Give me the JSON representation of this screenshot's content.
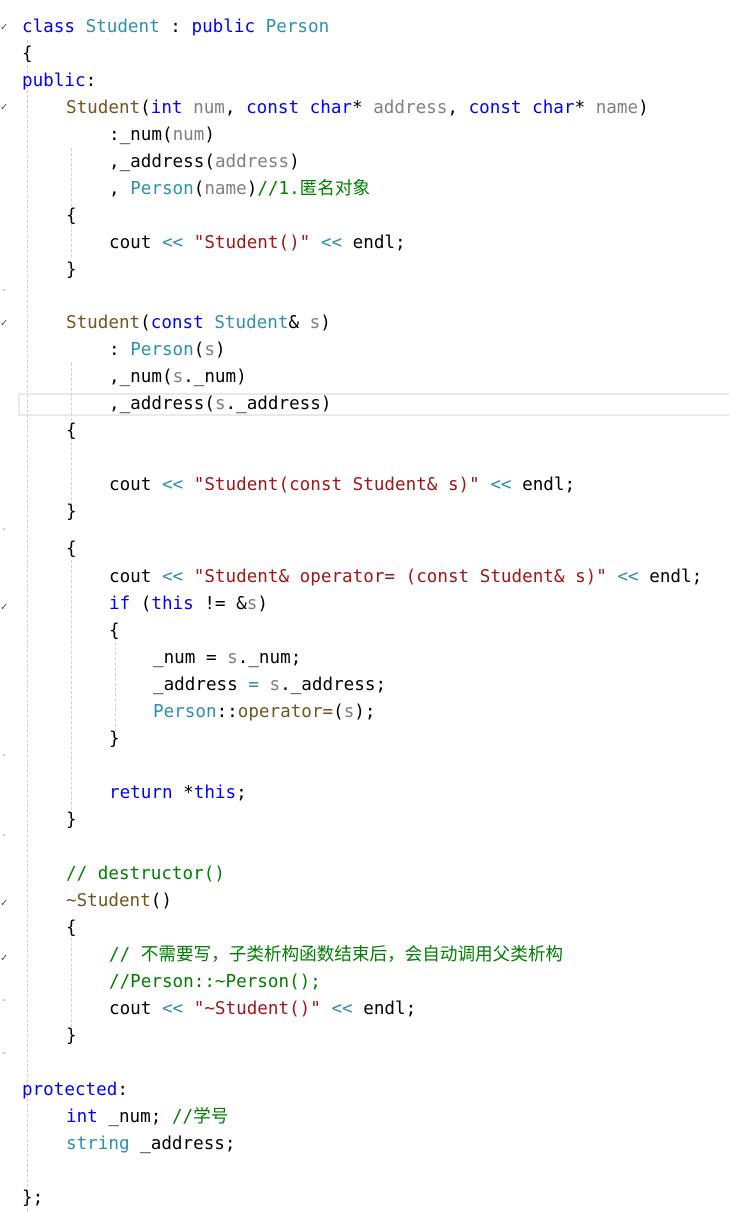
{
  "lines": [
    {
      "indent": 0,
      "tokens": [
        [
          "kw",
          "class"
        ],
        [
          "op",
          " "
        ],
        [
          "ty",
          "Student"
        ],
        [
          "op",
          " : "
        ],
        [
          "kw",
          "public"
        ],
        [
          "op",
          " "
        ],
        [
          "ty",
          "Person"
        ]
      ]
    },
    {
      "indent": 0,
      "tokens": [
        [
          "op",
          "{"
        ]
      ]
    },
    {
      "indent": 0,
      "tokens": [
        [
          "kw",
          "public"
        ],
        [
          "op",
          ":"
        ]
      ]
    },
    {
      "indent": 1,
      "tokens": [
        [
          "fn",
          "Student"
        ],
        [
          "op",
          "("
        ],
        [
          "kw",
          "int"
        ],
        [
          "op",
          " "
        ],
        [
          "pm",
          "num"
        ],
        [
          "op",
          ", "
        ],
        [
          "kw",
          "const"
        ],
        [
          "op",
          " "
        ],
        [
          "kw",
          "char"
        ],
        [
          "op",
          "* "
        ],
        [
          "pm",
          "address"
        ],
        [
          "op",
          ", "
        ],
        [
          "kw",
          "const"
        ],
        [
          "op",
          " "
        ],
        [
          "kw",
          "char"
        ],
        [
          "op",
          "* "
        ],
        [
          "pm",
          "name"
        ],
        [
          "op",
          ")"
        ]
      ]
    },
    {
      "indent": 2,
      "tokens": [
        [
          "op",
          ":"
        ],
        [
          "mb",
          "_num"
        ],
        [
          "op",
          "("
        ],
        [
          "pm",
          "num"
        ],
        [
          "op",
          ")"
        ]
      ]
    },
    {
      "indent": 2,
      "tokens": [
        [
          "op",
          ","
        ],
        [
          "mb",
          "_address"
        ],
        [
          "op",
          "("
        ],
        [
          "pm",
          "address"
        ],
        [
          "op",
          ")"
        ]
      ]
    },
    {
      "indent": 2,
      "tokens": [
        [
          "op",
          ", "
        ],
        [
          "ty",
          "Person"
        ],
        [
          "op",
          "("
        ],
        [
          "pm",
          "name"
        ],
        [
          "op",
          ")"
        ],
        [
          "cm",
          "//1.匿名对象"
        ]
      ]
    },
    {
      "indent": 1,
      "tokens": [
        [
          "op",
          "{"
        ]
      ]
    },
    {
      "indent": 2,
      "tokens": [
        [
          "mb",
          "cout"
        ],
        [
          "op",
          " "
        ],
        [
          "ty",
          "<<"
        ],
        [
          "op",
          " "
        ],
        [
          "st",
          "\"Student()\""
        ],
        [
          "op",
          " "
        ],
        [
          "ty",
          "<<"
        ],
        [
          "op",
          " endl;"
        ]
      ]
    },
    {
      "indent": 1,
      "tokens": [
        [
          "op",
          "}"
        ]
      ]
    },
    {
      "indent": 0,
      "tokens": []
    },
    {
      "indent": 1,
      "tokens": [
        [
          "fn",
          "Student"
        ],
        [
          "op",
          "("
        ],
        [
          "kw",
          "const"
        ],
        [
          "op",
          " "
        ],
        [
          "ty",
          "Student"
        ],
        [
          "op",
          "& "
        ],
        [
          "pm",
          "s"
        ],
        [
          "op",
          ")"
        ]
      ]
    },
    {
      "indent": 2,
      "tokens": [
        [
          "op",
          ": "
        ],
        [
          "ty",
          "Person"
        ],
        [
          "op",
          "("
        ],
        [
          "pm",
          "s"
        ],
        [
          "op",
          ")"
        ]
      ]
    },
    {
      "indent": 2,
      "tokens": [
        [
          "op",
          ","
        ],
        [
          "mb",
          "_num"
        ],
        [
          "op",
          "("
        ],
        [
          "pm",
          "s"
        ],
        [
          "op",
          "."
        ],
        [
          "mb",
          "_num"
        ],
        [
          "op",
          ")"
        ]
      ]
    },
    {
      "indent": 2,
      "tokens": [
        [
          "op",
          ","
        ],
        [
          "mb",
          "_address"
        ],
        [
          "op",
          "("
        ],
        [
          "pm",
          "s"
        ],
        [
          "op",
          "."
        ],
        [
          "mb",
          "_address"
        ],
        [
          "op",
          ")"
        ]
      ]
    },
    {
      "indent": 1,
      "tokens": [
        [
          "op",
          "{"
        ]
      ]
    },
    {
      "indent": 0,
      "tokens": []
    },
    {
      "indent": 2,
      "tokens": [
        [
          "mb",
          "cout"
        ],
        [
          "op",
          " "
        ],
        [
          "ty",
          "<<"
        ],
        [
          "op",
          " "
        ],
        [
          "st",
          "\"Student(const Student& s)\""
        ],
        [
          "op",
          " "
        ],
        [
          "ty",
          "<<"
        ],
        [
          "op",
          " endl;"
        ]
      ]
    },
    {
      "indent": 1,
      "tokens": [
        [
          "op",
          "}"
        ]
      ]
    },
    {
      "indent": 0,
      "tokens": []
    },
    {
      "indent": 1,
      "tokens": [
        [
          "op",
          "{"
        ]
      ]
    },
    {
      "indent": 2,
      "tokens": [
        [
          "mb",
          "cout"
        ],
        [
          "op",
          " "
        ],
        [
          "ty",
          "<<"
        ],
        [
          "op",
          " "
        ],
        [
          "st",
          "\"Student& operator= (const Student& s)\""
        ],
        [
          "op",
          " "
        ],
        [
          "ty",
          "<<"
        ],
        [
          "op",
          " endl;"
        ]
      ]
    },
    {
      "indent": 2,
      "tokens": [
        [
          "kw",
          "if"
        ],
        [
          "op",
          " ("
        ],
        [
          "kw",
          "this"
        ],
        [
          "op",
          " != &"
        ],
        [
          "pm",
          "s"
        ],
        [
          "op",
          ")"
        ]
      ]
    },
    {
      "indent": 2,
      "tokens": [
        [
          "op",
          "{"
        ]
      ]
    },
    {
      "indent": 3,
      "tokens": [
        [
          "mb",
          "_num"
        ],
        [
          "op",
          " = "
        ],
        [
          "pm",
          "s"
        ],
        [
          "op",
          "."
        ],
        [
          "mb",
          "_num"
        ],
        [
          "op",
          ";"
        ]
      ]
    },
    {
      "indent": 3,
      "tokens": [
        [
          "mb",
          "_address"
        ],
        [
          "op",
          " "
        ],
        [
          "ty",
          "="
        ],
        [
          "op",
          " "
        ],
        [
          "pm",
          "s"
        ],
        [
          "op",
          "."
        ],
        [
          "mb",
          "_address"
        ],
        [
          "op",
          ";"
        ]
      ]
    },
    {
      "indent": 3,
      "tokens": [
        [
          "ty",
          "Person"
        ],
        [
          "op",
          "::"
        ],
        [
          "fn",
          "operator="
        ],
        [
          "op",
          "("
        ],
        [
          "pm",
          "s"
        ],
        [
          "op",
          ");"
        ]
      ]
    },
    {
      "indent": 2,
      "tokens": [
        [
          "op",
          "}"
        ]
      ]
    },
    {
      "indent": 0,
      "tokens": []
    },
    {
      "indent": 2,
      "tokens": [
        [
          "kw",
          "return"
        ],
        [
          "op",
          " *"
        ],
        [
          "kw",
          "this"
        ],
        [
          "op",
          ";"
        ]
      ]
    },
    {
      "indent": 1,
      "tokens": [
        [
          "op",
          "}"
        ]
      ]
    },
    {
      "indent": 0,
      "tokens": []
    },
    {
      "indent": 1,
      "tokens": [
        [
          "cm",
          "// destructor()"
        ]
      ]
    },
    {
      "indent": 1,
      "tokens": [
        [
          "fn",
          "~Student"
        ],
        [
          "op",
          "()"
        ]
      ]
    },
    {
      "indent": 1,
      "tokens": [
        [
          "op",
          "{"
        ]
      ]
    },
    {
      "indent": 2,
      "tokens": [
        [
          "cm",
          "// 不需要写，子类析构函数结束后，会自动调用父类析构"
        ]
      ]
    },
    {
      "indent": 2,
      "tokens": [
        [
          "cm",
          "//Person::~Person();"
        ]
      ]
    },
    {
      "indent": 2,
      "tokens": [
        [
          "mb",
          "cout"
        ],
        [
          "op",
          " "
        ],
        [
          "ty",
          "<<"
        ],
        [
          "op",
          " "
        ],
        [
          "st",
          "\"~Student()\""
        ],
        [
          "op",
          " "
        ],
        [
          "ty",
          "<<"
        ],
        [
          "op",
          " endl;"
        ]
      ]
    },
    {
      "indent": 1,
      "tokens": [
        [
          "op",
          "}"
        ]
      ]
    },
    {
      "indent": 0,
      "tokens": []
    },
    {
      "indent": 0,
      "tokens": [
        [
          "kw",
          "protected"
        ],
        [
          "op",
          ":"
        ]
      ]
    },
    {
      "indent": 1,
      "tokens": [
        [
          "kw",
          "int"
        ],
        [
          "op",
          " _num; "
        ],
        [
          "cm",
          "//学号"
        ]
      ]
    },
    {
      "indent": 1,
      "tokens": [
        [
          "ty",
          "string"
        ],
        [
          "op",
          " _address;"
        ]
      ]
    },
    {
      "indent": 0,
      "tokens": []
    },
    {
      "indent": 0,
      "tokens": [
        [
          "op",
          "};"
        ]
      ]
    }
  ]
}
